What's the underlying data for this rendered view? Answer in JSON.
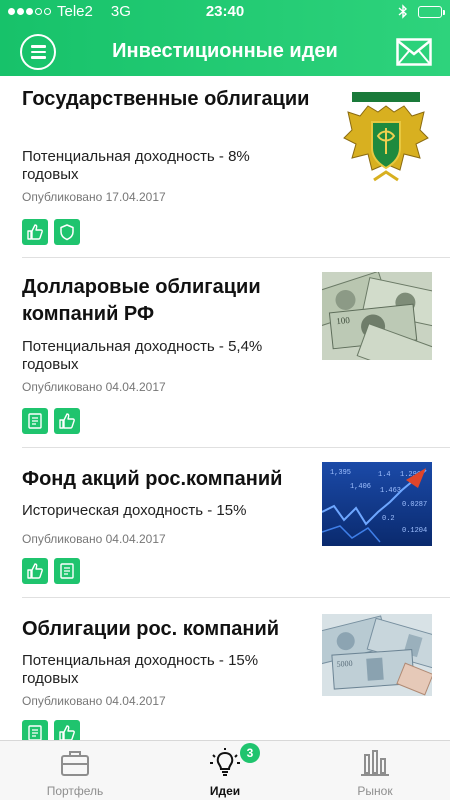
{
  "status_bar": {
    "carrier": "Tele2",
    "network": "3G",
    "time": "23:40"
  },
  "header": {
    "title": "Инвестиционные идеи"
  },
  "ideas": [
    {
      "title": "Государственные облигации",
      "yield": "Потенциальная доходность - 8% годовых",
      "date": "Опубликовано 17.04.2017",
      "badges": [
        "thumbs-up-icon",
        "shield-icon"
      ],
      "image": "coat-of-arms"
    },
    {
      "title": "Долларовые облигации компаний РФ",
      "yield": "Потенциальная доходность - 5,4% годовых",
      "date": "Опубликовано 04.04.2017",
      "badges": [
        "document-icon",
        "thumbs-up-icon"
      ],
      "image": "dollar-bills"
    },
    {
      "title": "Фонд акций рос.компаний",
      "yield": "Историческая доходность - 15%",
      "date": "Опубликовано 04.04.2017",
      "badges": [
        "thumbs-up-icon",
        "document-icon"
      ],
      "image": "stock-chart"
    },
    {
      "title": "Облигации рос. компаний",
      "yield": "Потенциальная доходность - 15% годовых",
      "date": "Опубликовано 04.04.2017",
      "badges": [
        "document-icon",
        "thumbs-up-icon"
      ],
      "image": "ruble-bills"
    }
  ],
  "tabbar": {
    "portfolio": "Портфель",
    "ideas": "Идеи",
    "ideas_badge": "3",
    "market": "Рынок"
  },
  "colors": {
    "accent": "#1fc46e",
    "header_start": "#17c26a",
    "header_end": "#2ed37c"
  }
}
